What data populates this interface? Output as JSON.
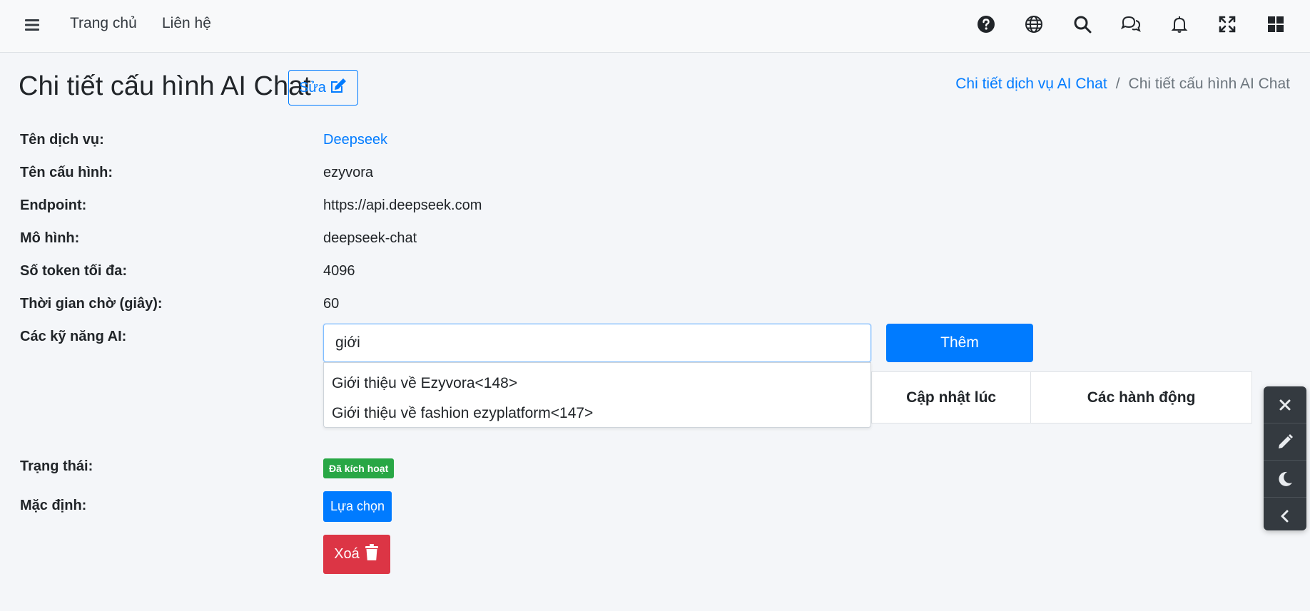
{
  "nav": {
    "links": [
      "Trang chủ",
      "Liên hệ"
    ],
    "icons": [
      "question-circle-icon",
      "globe-icon",
      "search-icon",
      "comments-icon",
      "bell-icon",
      "expand-icon",
      "grid-icon"
    ]
  },
  "header": {
    "title": "Chi tiết cấu hình AI Chat",
    "edit_label": "Sửa"
  },
  "breadcrumb": {
    "parent": "Chi tiết dịch vụ AI Chat",
    "separator": "/",
    "current": "Chi tiết cấu hình AI Chat"
  },
  "details": {
    "service_label": "Tên dịch vụ:",
    "service_value": "Deepseek",
    "config_label": "Tên cấu hình:",
    "config_value": "ezyvora",
    "endpoint_label": "Endpoint:",
    "endpoint_value": "https://api.deepseek.com",
    "model_label": "Mô hình:",
    "model_value": "deepseek-chat",
    "max_tokens_label": "Số token tối đa:",
    "max_tokens_value": "4096",
    "timeout_label": "Thời gian chờ (giây):",
    "timeout_value": "60",
    "skills_label": "Các kỹ năng AI:",
    "status_label": "Trạng thái:",
    "status_badge": "Đã kích hoạt",
    "default_label": "Mặc định:"
  },
  "skills": {
    "input_value": "giới",
    "add_label": "Thêm",
    "suggestions": [
      "Giới thiệu về Ezyvora<148>",
      "Giới thiệu về fashion ezyplatform<147>"
    ],
    "table_headers": [
      "Cập nhật lúc",
      "Các hành động"
    ]
  },
  "actions": {
    "select_label": "Lựa chọn",
    "delete_label": "Xoá"
  },
  "colors": {
    "primary": "#007bff",
    "success": "#28a745",
    "danger": "#dc3545",
    "dark_panel": "#343a40"
  }
}
